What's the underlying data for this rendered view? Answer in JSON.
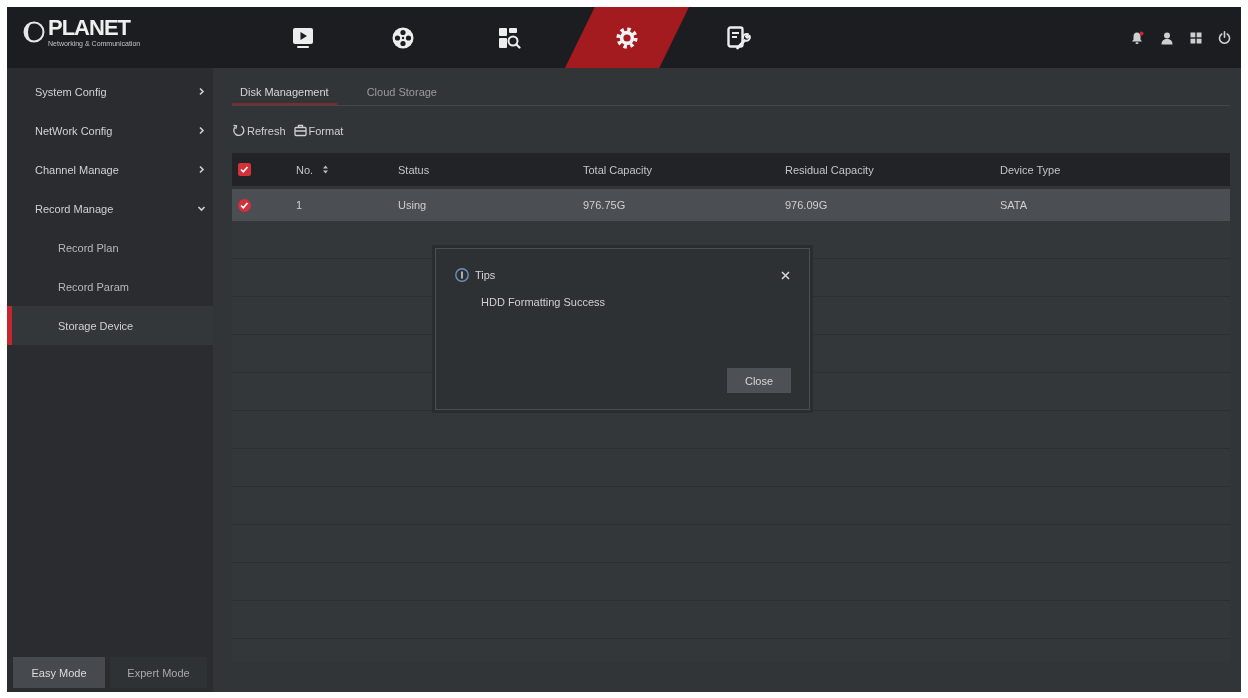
{
  "top_bar": {
    "logo": {
      "name": "PLANET",
      "tagline": "Networking & Communication"
    },
    "main_menu": [
      {
        "kind": "playback",
        "selected": false
      },
      {
        "kind": "reel",
        "selected": false
      },
      {
        "kind": "search",
        "selected": false
      },
      {
        "kind": "settings",
        "selected": true
      },
      {
        "kind": "maintenance",
        "selected": false
      }
    ]
  },
  "sidebar": {
    "items": [
      {
        "label": "System Config",
        "expanded": false
      },
      {
        "label": "NetWork Config",
        "expanded": false
      },
      {
        "label": "Channel Manage",
        "expanded": false
      },
      {
        "label": "Record Manage",
        "expanded": true,
        "children": [
          {
            "label": "Record Plan",
            "selected": false
          },
          {
            "label": "Record Param",
            "selected": false
          },
          {
            "label": "Storage Device",
            "selected": true
          }
        ]
      }
    ],
    "modes": [
      {
        "label": "Easy Mode",
        "selected": true
      },
      {
        "label": "Expert Mode",
        "selected": false
      }
    ]
  },
  "tabs": [
    {
      "label": "Disk Management",
      "selected": true
    },
    {
      "label": "Cloud Storage",
      "selected": false
    }
  ],
  "toolbar": [
    {
      "kind": "refresh",
      "label": "Refresh"
    },
    {
      "kind": "format",
      "label": "Format"
    }
  ],
  "table": {
    "all_checked": true,
    "columns": [
      {
        "label": "No.",
        "sortable": true
      },
      {
        "label": "Status",
        "sortable": false
      },
      {
        "label": "Total Capacity",
        "sortable": false
      },
      {
        "label": "Residual Capacity",
        "sortable": false
      },
      {
        "label": "Device Type",
        "sortable": false
      }
    ],
    "rows": [
      {
        "checked": true,
        "selected": true,
        "cells": [
          "1",
          "Using",
          "976.75G",
          "976.09G",
          "SATA"
        ]
      }
    ]
  },
  "dialog": {
    "title": "Tips",
    "message": "HDD Formatting Success",
    "button": "Close"
  }
}
